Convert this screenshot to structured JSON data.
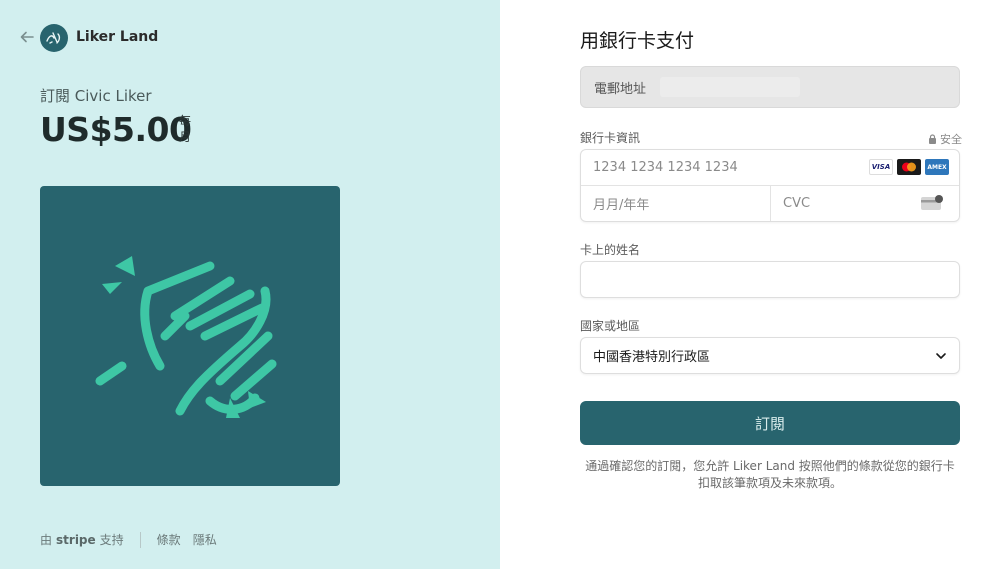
{
  "brand": {
    "name": "Liker Land",
    "logo_icon": "liker-land-logo-icon"
  },
  "product": {
    "name": "訂閱 Civic Liker",
    "price": "US$5.00",
    "period": "每月"
  },
  "hero": {
    "icon": "clapping-hands-icon",
    "background": "#28646e",
    "accent": "#3ec7a5"
  },
  "footer": {
    "powered_prefix": "由",
    "powered_brand": "stripe",
    "powered_suffix": "支持",
    "terms": "條款",
    "privacy": "隱私"
  },
  "form": {
    "title": "用銀行卡支付",
    "email_label": "電郵地址",
    "card_label": "銀行卡資訊",
    "secure_label": "安全",
    "card_number_placeholder": "1234 1234 1234 1234",
    "expiry_placeholder": "月月/年年",
    "cvc_placeholder": "CVC",
    "card_brands": [
      "VISA",
      "mastercard",
      "AMEX"
    ],
    "name_label": "卡上的姓名",
    "name_value": "",
    "country_label": "國家或地區",
    "country_value": "中國香港特別行政區",
    "submit_label": "訂閱",
    "terms_text": "通過確認您的訂閱，您允許 Liker Land 按照他們的條款從您的銀行卡扣取該筆款項及未來款項。"
  },
  "colors": {
    "left_bg": "#d2efef",
    "primary": "#28646e",
    "accent": "#3ec7a5"
  }
}
